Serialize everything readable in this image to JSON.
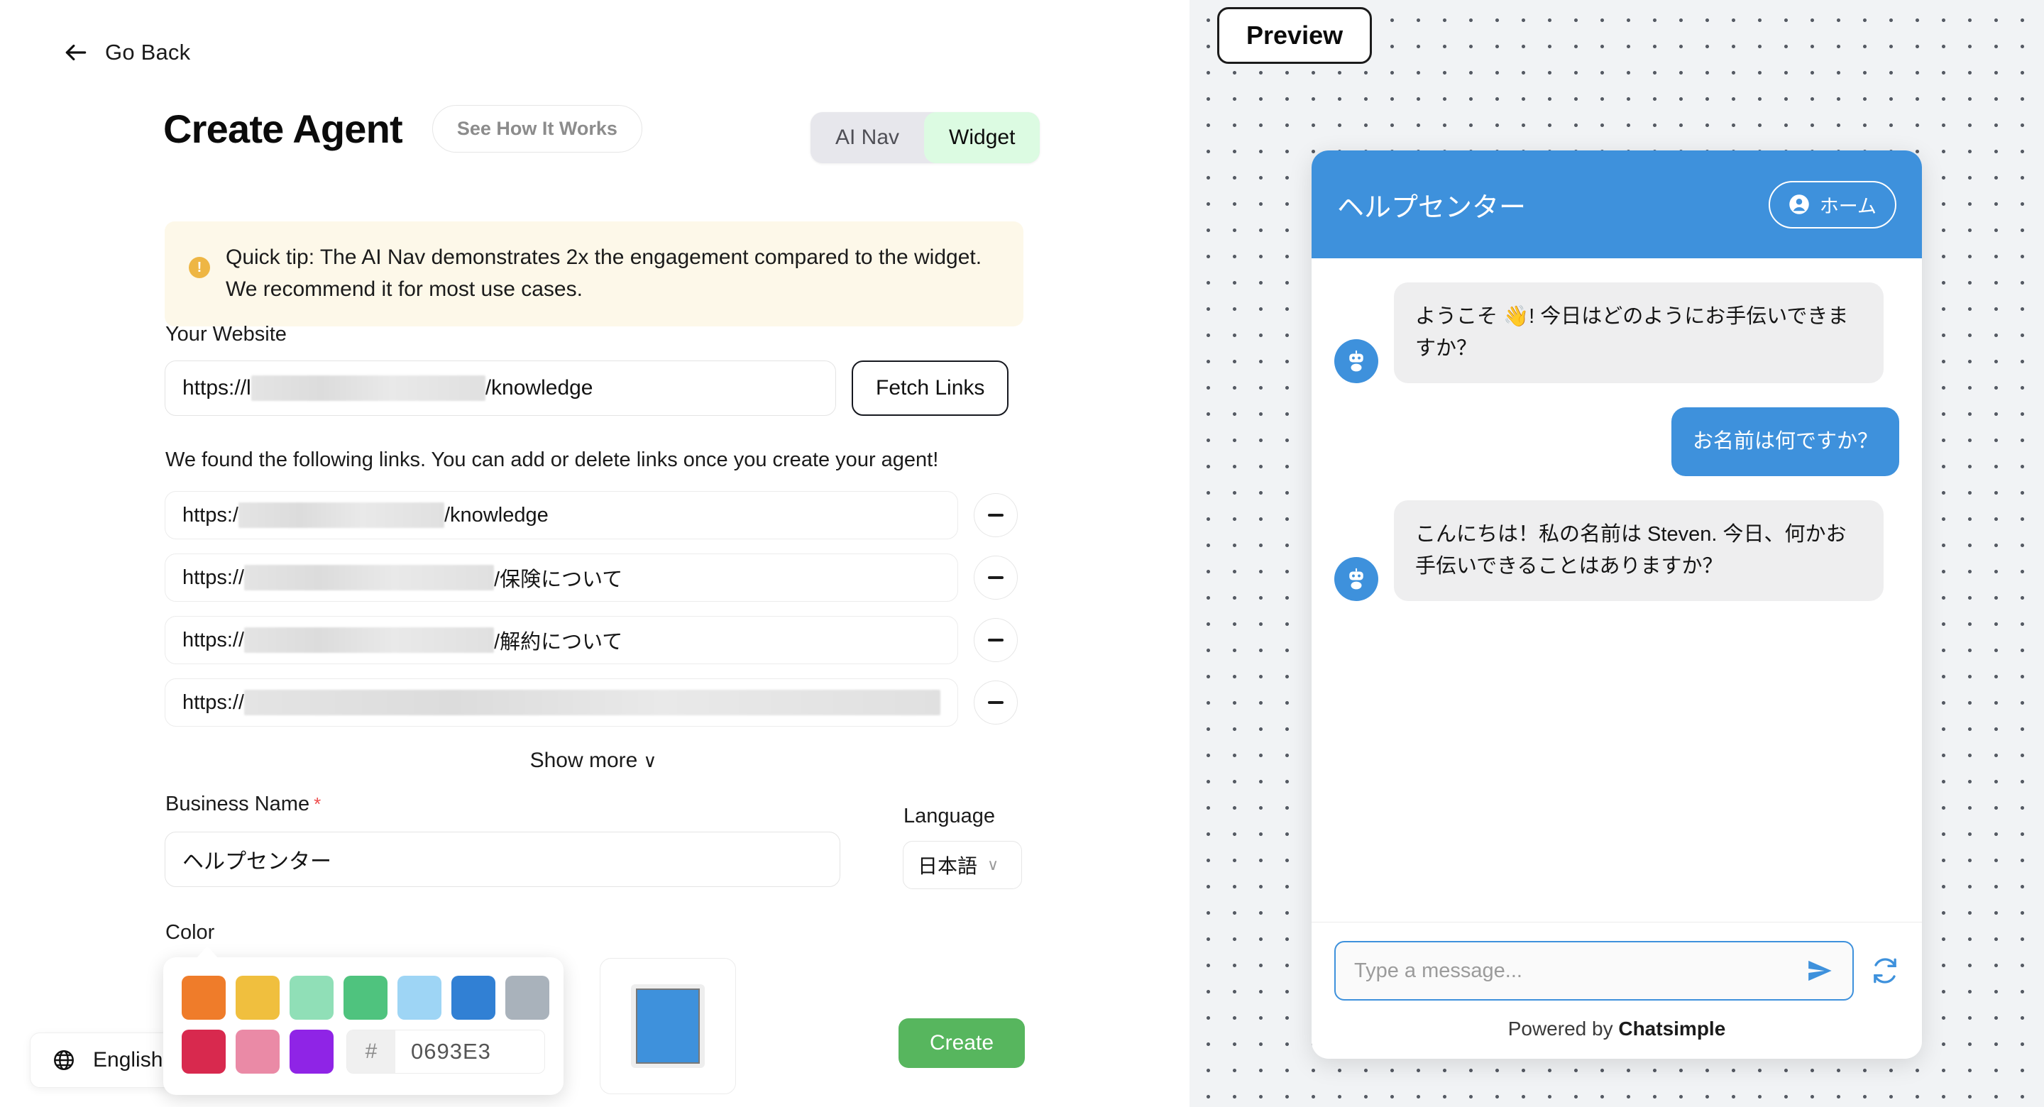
{
  "left": {
    "go_back": "Go Back",
    "page_title": "Create Agent",
    "see_how_it_works": "See How It Works",
    "mode_toggle": {
      "options": [
        "AI Nav",
        "Widget"
      ],
      "selected": "Widget"
    },
    "tip": {
      "icon": "exclamation-icon",
      "text": "Quick tip: The AI Nav demonstrates 2x the engagement compared to the widget. We recommend it for most use cases."
    },
    "website": {
      "label": "Your Website",
      "prefix": "https://l",
      "suffix": "/knowledge",
      "redacted": true,
      "fetch_button": "Fetch Links"
    },
    "links": {
      "help_text": "We found the following links. You can add or delete links once you create your agent!",
      "items": [
        {
          "prefix": "https:/",
          "suffix": "/knowledge",
          "redacted_width": 290
        },
        {
          "prefix": "https://",
          "suffix": "/保険について",
          "redacted_width": 352
        },
        {
          "prefix": "https://",
          "suffix": "/解約について",
          "redacted_width": 352
        },
        {
          "prefix": "https://",
          "suffix": "",
          "redacted_width": 1020
        }
      ],
      "remove_icon": "minus-icon",
      "show_more": "Show more",
      "show_more_chevron": "∨"
    },
    "business_name": {
      "label": "Business Name",
      "required_marker": "*",
      "value": "ヘルプセンター"
    },
    "language": {
      "label": "Language",
      "value": "日本語",
      "chevron": "∨"
    },
    "color": {
      "label": "Color",
      "swatches_row1": [
        "#ef7c2a",
        "#f0bf3e",
        "#90dfb7",
        "#4fc37e",
        "#9ed5f5",
        "#3180d4",
        "#a9b2bb"
      ],
      "swatches_row2": [
        "#d8294e",
        "#ea8aa6",
        "#8f24e6"
      ],
      "hex_prefix": "#",
      "hex_value": "0693E3",
      "preview_color": "#3e91dc"
    },
    "create_button": "Create",
    "floating_language": {
      "icon": "globe-icon",
      "label": "English"
    }
  },
  "right": {
    "preview_badge": "Preview",
    "widget": {
      "header": {
        "title": "ヘルプセンター",
        "home_icon": "user-circle-icon",
        "home_label": "ホーム",
        "background": "#3e91dc"
      },
      "messages": [
        {
          "sender": "bot",
          "avatar_icon": "robot-icon",
          "text": "ようこそ 👋! 今日はどのようにお手伝いできますか？"
        },
        {
          "sender": "user",
          "text": "お名前は何ですか？"
        },
        {
          "sender": "bot",
          "avatar_icon": "robot-icon",
          "text": "こんにちは！私の名前は Steven. 今日、何かお手伝いできることはありますか？"
        }
      ],
      "input_placeholder": "Type a message...",
      "send_icon": "send-paper-plane-icon",
      "refresh_icon": "refresh-icon",
      "powered_prefix": "Powered by ",
      "powered_brand": "Chatsimple"
    }
  }
}
